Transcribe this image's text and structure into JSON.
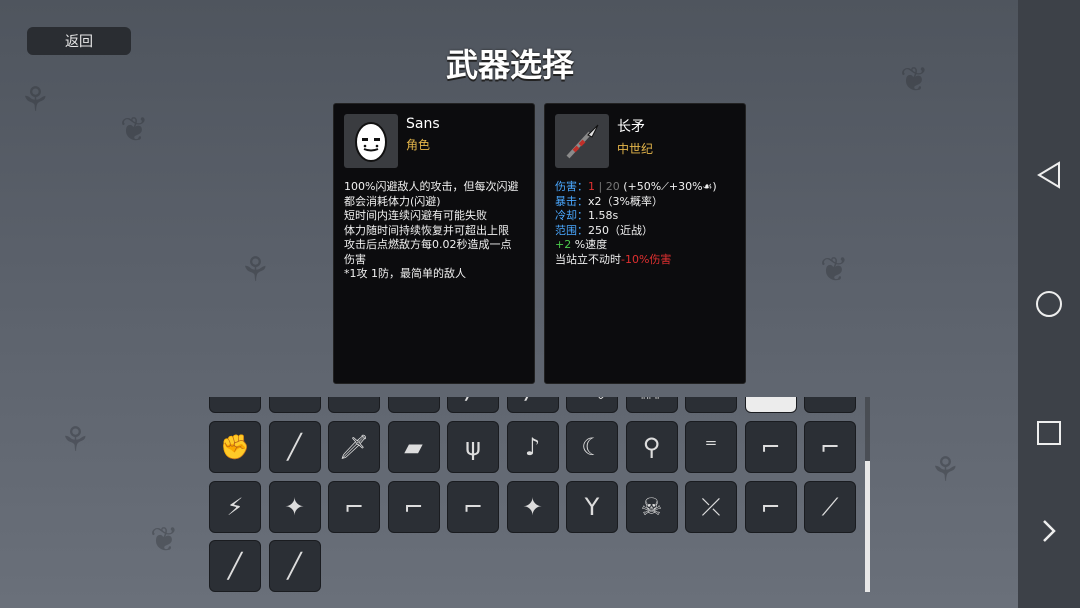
{
  "header": {
    "back_label": "返回",
    "title": "武器选择"
  },
  "character_card": {
    "name": "Sans",
    "subtitle": "角色",
    "description": [
      "100%闪避敌人的攻击，但每次闪避",
      "都会消耗体力(闪避)",
      "短时间内连续闪避有可能失败",
      "体力随时间持续恢复并可超出上限",
      "攻击后点燃敌方每0.02秒造成一点",
      "伤害",
      "*1攻 1防，最简单的敌人"
    ]
  },
  "weapon_card": {
    "name": "长矛",
    "subtitle": "中世纪",
    "damage_key": "伤害：",
    "damage_value": "1",
    "damage_sep": " | ",
    "damage_max": "20",
    "damage_bonus": " (+50%⟋+30%☙)",
    "crit_key": "暴击：",
    "crit_value": "x2（3%概率）",
    "cooldown_key": "冷却：",
    "cooldown_value": "1.58s",
    "range_key": "范围：",
    "range_value": "250（近战）",
    "speed_bonus": "+2",
    "speed_label": " %速度",
    "standing_text": "当站立不动时",
    "standing_penalty": "-10%伤害"
  },
  "weapon_grid": {
    "partial_row": [
      "whip-icon",
      "scissors-icon",
      "knife-icon",
      "wrench-icon",
      "pipe-icon",
      "bat-icon",
      "pickaxe-icon",
      "chain-icon",
      "nunchaku-icon",
      "spear-icon",
      "bow-icon"
    ],
    "selected_index": 9,
    "rows": [
      [
        "power-fist-icon",
        "stick-icon",
        "bloody-knife-icon",
        "brick-icon",
        "trident-icon",
        "lute-icon",
        "sickle-icon",
        "spoon-icon",
        "double-barrel-icon",
        "laser-gun-icon",
        "blaster-icon"
      ],
      [
        "taser-icon",
        "magic-wand-icon",
        "plasma-gun-icon",
        "red-blaster-icon",
        "megaphone-gun-icon",
        "shuriken-icon",
        "slingshot-icon",
        "skull-staff-icon",
        "crossbow-icon",
        "hand-cannon-icon",
        "fang-icon"
      ],
      [
        "bamboo-staff-icon",
        "blowgun-icon"
      ]
    ]
  },
  "navbar": {
    "buttons": [
      "back-triangle-icon",
      "home-circle-icon",
      "recents-square-icon",
      "forward-chevron-icon"
    ]
  },
  "colors": {
    "accent_gold": "#e5b64a",
    "stat_blue": "#4aa8ff",
    "damage_red": "#e03030",
    "bonus_green": "#4ccc4c",
    "card_bg": "#0c0c0e"
  }
}
